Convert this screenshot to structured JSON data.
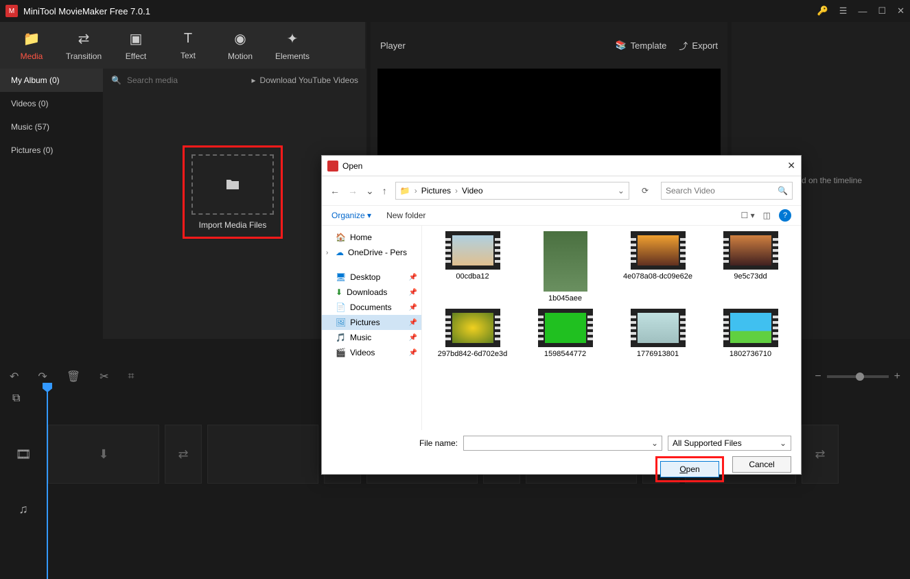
{
  "app": {
    "title": "MiniTool MovieMaker Free 7.0.1"
  },
  "tabs": [
    {
      "label": "Media",
      "icon": "folder-icon"
    },
    {
      "label": "Transition",
      "icon": "swap-icon"
    },
    {
      "label": "Effect",
      "icon": "sparkle-icon"
    },
    {
      "label": "Text",
      "icon": "text-icon"
    },
    {
      "label": "Motion",
      "icon": "motion-icon"
    },
    {
      "label": "Elements",
      "icon": "elements-icon"
    }
  ],
  "media_nav": [
    {
      "label": "My Album (0)"
    },
    {
      "label": "Videos (0)"
    },
    {
      "label": "Music (57)"
    },
    {
      "label": "Pictures (0)"
    }
  ],
  "search": {
    "placeholder": "Search media"
  },
  "download_youtube": "Download YouTube Videos",
  "import_label": "Import Media Files",
  "player": {
    "label": "Player",
    "template": "Template",
    "export": "Export"
  },
  "right_hint": "elected on the timeline",
  "dialog": {
    "title": "Open",
    "breadcrumb": [
      "Pictures",
      "Video"
    ],
    "search_placeholder": "Search Video",
    "organize": "Organize",
    "new_folder": "New folder",
    "tree": [
      {
        "label": "Home",
        "icon": "home-icon"
      },
      {
        "label": "OneDrive - Pers",
        "icon": "cloud-icon",
        "expand": true
      },
      {
        "label": "Desktop",
        "icon": "desktop-icon",
        "pin": true
      },
      {
        "label": "Downloads",
        "icon": "download-icon",
        "pin": true
      },
      {
        "label": "Documents",
        "icon": "document-icon",
        "pin": true
      },
      {
        "label": "Pictures",
        "icon": "picture-icon",
        "pin": true,
        "selected": true
      },
      {
        "label": "Music",
        "icon": "music-icon",
        "pin": true
      },
      {
        "label": "Videos",
        "icon": "video-icon",
        "pin": true
      }
    ],
    "files": [
      {
        "name": "00cdba12",
        "thumb": "t-sky"
      },
      {
        "name": "1b045aee",
        "thumb": "t-forest",
        "tall": true
      },
      {
        "name": "4e078a08-dc09e62e",
        "thumb": "t-sunset"
      },
      {
        "name": "9e5c73dd",
        "thumb": "t-sunset2"
      },
      {
        "name": "297bd842-6d702e3d",
        "thumb": "t-flower"
      },
      {
        "name": "1598544772",
        "thumb": "t-green"
      },
      {
        "name": "1776913801",
        "thumb": "t-white"
      },
      {
        "name": "1802736710",
        "thumb": "t-cartoon"
      }
    ],
    "filename_label": "File name:",
    "filter": "All Supported Files",
    "open": "Open",
    "cancel": "Cancel"
  }
}
